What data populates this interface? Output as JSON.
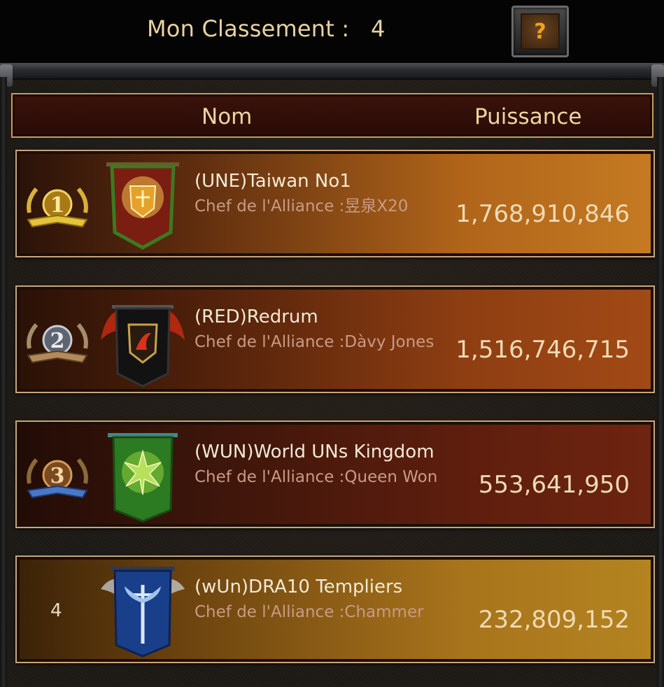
{
  "header": {
    "rank_label": "Mon Classement :",
    "rank_value": "4",
    "help_icon": "question-mark-icon",
    "help_label": "?"
  },
  "columns": {
    "name": "Nom",
    "power": "Puissance"
  },
  "leader_prefix": "Chef de l'Alliance :",
  "rows": [
    {
      "rank": "1",
      "rank_icon": "gold-laurel-1-badge-icon",
      "banner_icon": "red-green-shield-banner-icon",
      "name": "(UNE)Taiwan No1",
      "leader": "昱泉X20",
      "power": "1,768,910,846",
      "accent": "#c4761c"
    },
    {
      "rank": "2",
      "rank_icon": "silver-laurel-2-badge-icon",
      "banner_icon": "black-dragon-winged-banner-icon",
      "name": "(RED)Redrum",
      "leader": "Dàvy Jones",
      "power": "1,516,746,715",
      "accent": "#b0561a"
    },
    {
      "rank": "3",
      "rank_icon": "bronze-laurel-3-badge-icon",
      "banner_icon": "green-leaf-banner-icon",
      "name": "(WUN)World UNs Kingdom",
      "leader": "Queen Won",
      "power": "553,641,950",
      "accent": "#8a3512"
    },
    {
      "rank": "4",
      "rank_icon": "",
      "banner_icon": "blue-winged-sword-banner-icon",
      "name": "(wUn)DRA10 Templiers",
      "leader": "Chammer",
      "power": "232,809,152",
      "accent": "#c98f22"
    }
  ]
}
